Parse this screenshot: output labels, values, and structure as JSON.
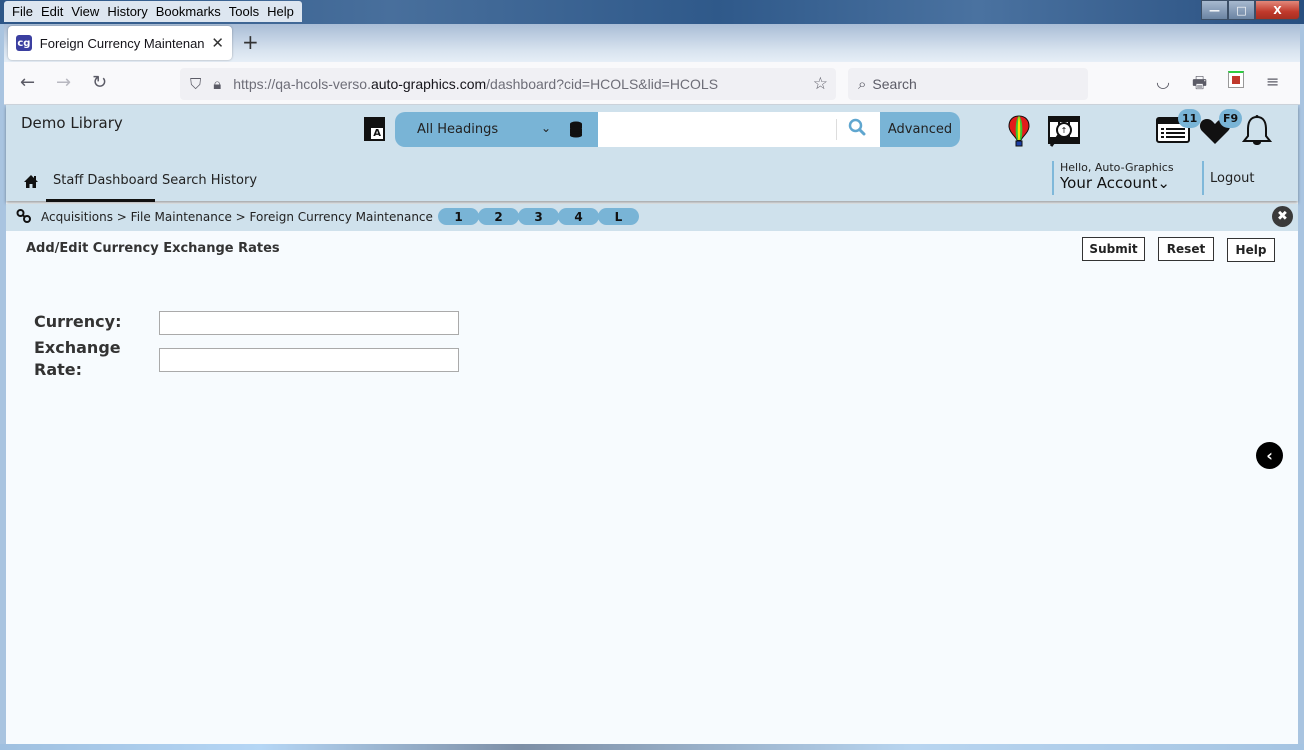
{
  "browser": {
    "menu": [
      "File",
      "Edit",
      "View",
      "History",
      "Bookmarks",
      "Tools",
      "Help"
    ],
    "tab": {
      "title": "Foreign Currency Maintenance",
      "favicon": "cg"
    },
    "new_tab": "+",
    "url_host_prefix": "https://qa-hcols-verso.",
    "url_host_main": "auto-graphics.com",
    "url_path": "/dashboard?cid=HCOLS&lid=HCOLS",
    "search_placeholder": "Search",
    "window_controls": {
      "minimize": "—",
      "maximize": "□",
      "close": "X"
    }
  },
  "header": {
    "library_name": "Demo Library",
    "search": {
      "scope": "All Headings",
      "query": "",
      "advanced_label": "Advanced"
    },
    "badges": {
      "list_count": "11",
      "favorites": "F9"
    },
    "nav": [
      {
        "label": "Staff Dashboard",
        "active": true
      },
      {
        "label": "Search History",
        "active": false
      }
    ],
    "account": {
      "greeting": "Hello, Auto-Graphics",
      "label": "Your Account⌄"
    },
    "logout_label": "Logout"
  },
  "breadcrumb": {
    "path": "Acquisitions > File Maintenance > Foreign Currency Maintenance",
    "pages": [
      "1",
      "2",
      "3",
      "4",
      "L"
    ]
  },
  "form": {
    "title": "Add/Edit Currency Exchange Rates",
    "buttons": {
      "submit": "Submit",
      "reset": "Reset",
      "help": "Help"
    },
    "fields": {
      "currency": {
        "label": "Currency:",
        "value": ""
      },
      "exchange_rate": {
        "label_line1": "Exchange",
        "label_line2": "Rate:",
        "value": ""
      }
    }
  },
  "colors": {
    "header_bg": "#cfe1ec",
    "accent": "#79b4d6",
    "page_bg": "#f7fbfe"
  }
}
